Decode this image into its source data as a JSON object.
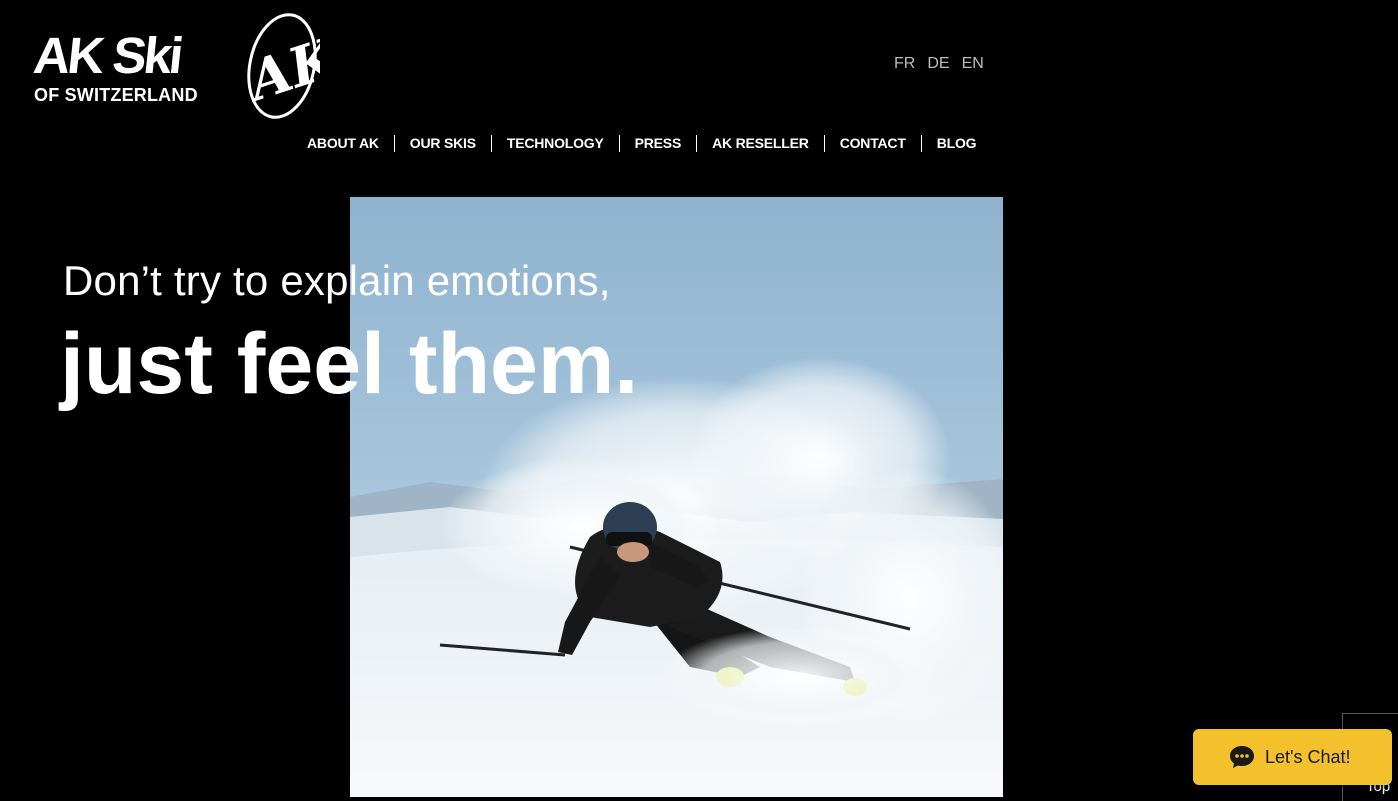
{
  "logo": {
    "brand": "AK Ski",
    "tagline": "OF SWITZERLAND",
    "emblem_letters": "AK"
  },
  "languages": [
    "FR",
    "DE",
    "EN"
  ],
  "nav": {
    "items": [
      {
        "label": "ABOUT AK"
      },
      {
        "label": "OUR SKIS"
      },
      {
        "label": "TECHNOLOGY"
      },
      {
        "label": "PRESS"
      },
      {
        "label": "AK RESELLER"
      },
      {
        "label": "CONTACT"
      },
      {
        "label": "BLOG"
      }
    ]
  },
  "hero": {
    "line1": "Don’t try to explain emotions,",
    "line2": "just feel them.",
    "image": "skier-carving-snow-photo"
  },
  "top_widget": {
    "label": "Top"
  },
  "chat": {
    "label": "Let's Chat!",
    "icon": "chat-bubble-icon",
    "color": "#f3c12c"
  },
  "colors": {
    "background": "#000000",
    "text": "#ffffff",
    "lang_text": "#bdbdbd",
    "accent": "#f3c12c"
  }
}
